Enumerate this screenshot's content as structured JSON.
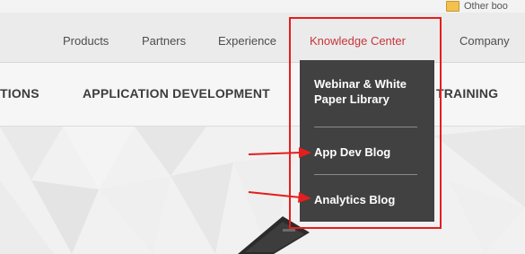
{
  "bookmarks": {
    "folder_label": "Other boo",
    "folder_icon": "folder-icon"
  },
  "top_nav": {
    "items": [
      "Products",
      "Partners",
      "Experience",
      "Knowledge Center",
      "Company"
    ],
    "active_index": 3,
    "active_color": "#c7353b"
  },
  "sub_nav": {
    "items": [
      "TIONS",
      "APPLICATION DEVELOPMENT",
      "TRAINING"
    ]
  },
  "dropdown": {
    "items": [
      "Webinar & White Paper Library",
      "App Dev Blog",
      "Analytics Blog"
    ],
    "background": "#414141"
  },
  "annotations": {
    "highlight_color": "#e41e1e",
    "arrow_color": "#e41e1e"
  }
}
